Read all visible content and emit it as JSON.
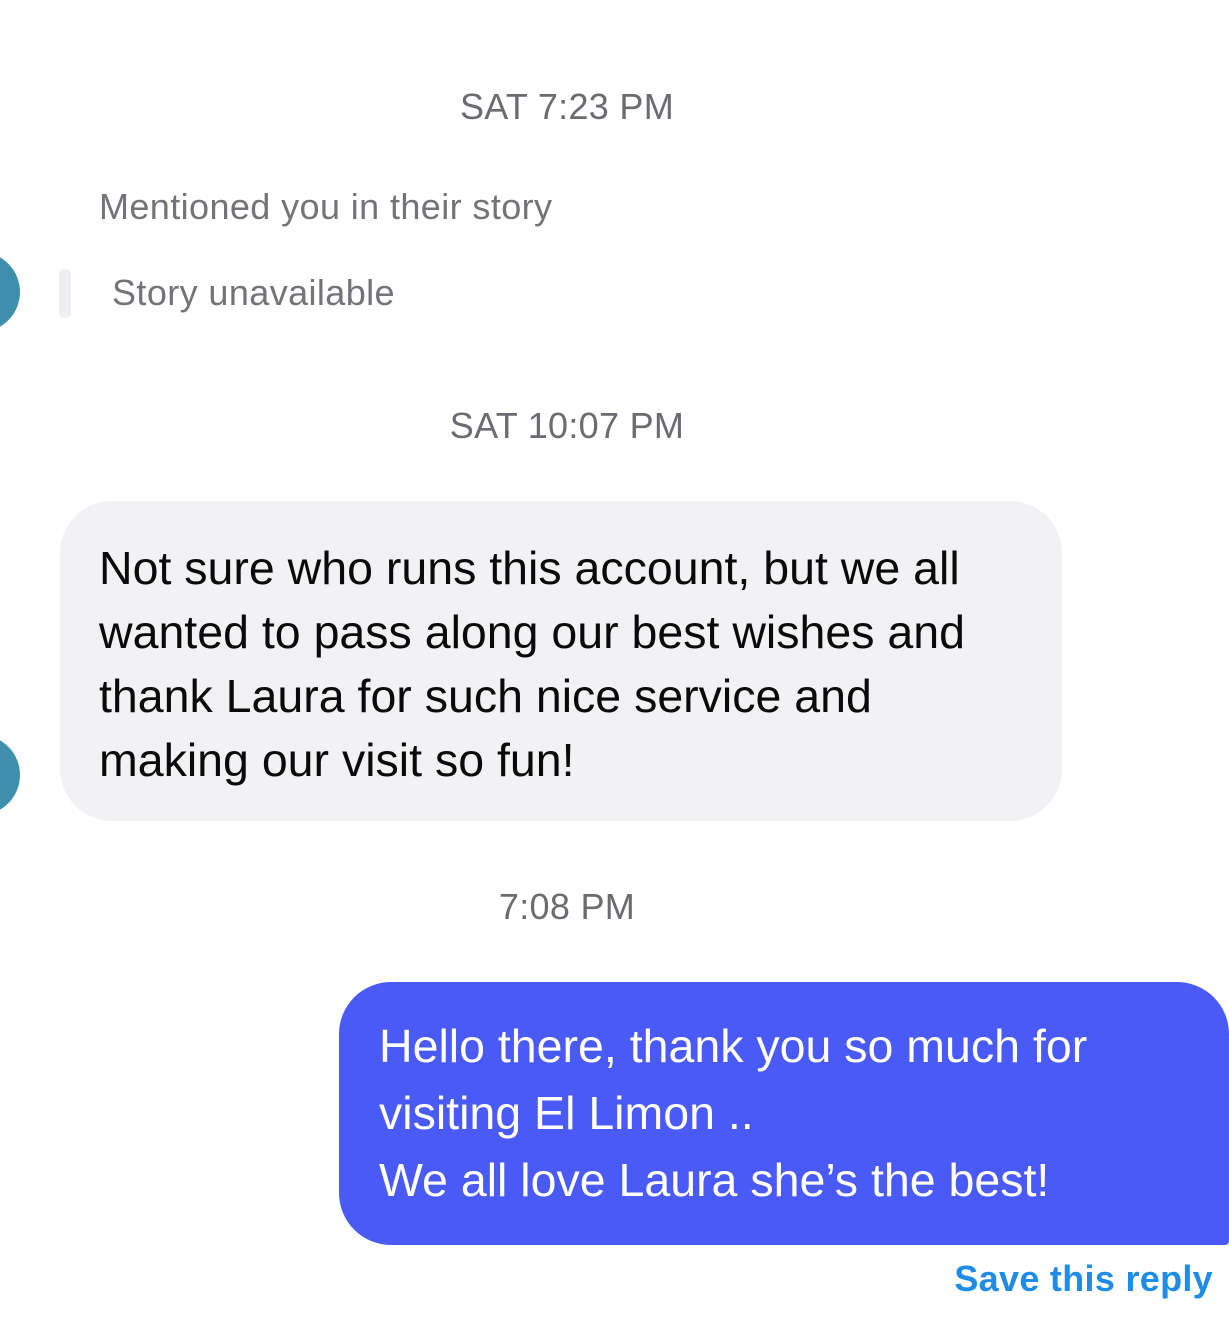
{
  "conversation": {
    "timestamps": [
      "SAT 7:23 PM",
      "SAT 10:07 PM",
      "7:08 PM"
    ],
    "story_mention": {
      "label": "Mentioned you in their story",
      "status": "Story unavailable"
    },
    "incoming_message": {
      "text": "Not sure who runs this account, but we all wanted to pass along our best wishes and thank Laura for such nice service and making our visit so fun!"
    },
    "outgoing_message": {
      "lines": [
        "Hello there, thank you so much for",
        "visiting El Limon ..",
        "We all love Laura she’s the best!"
      ]
    },
    "save_reply_label": "Save this reply"
  },
  "colors": {
    "outgoing_bubble": "#4a5af7",
    "incoming_bubble": "#f2f2f4",
    "link_blue": "#1f8ce6",
    "avatar": "#3e8fad"
  },
  "icons": {
    "avatar": "contact-avatar-partial"
  }
}
